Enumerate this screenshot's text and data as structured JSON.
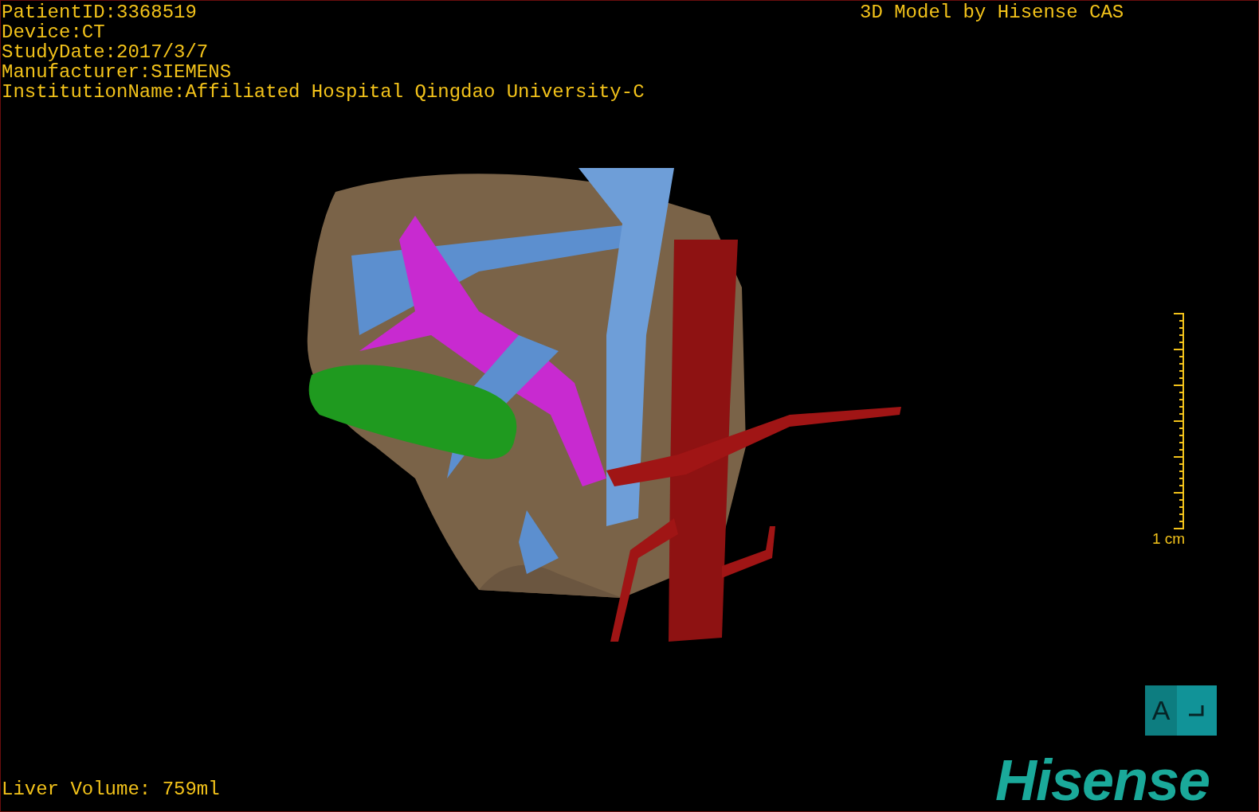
{
  "overlay_top_left": [
    "PatientID:3368519",
    "Device:CT",
    "StudyDate:2017/3/7",
    "Manufacturer:SIEMENS",
    "InstitutionName:Affiliated Hospital Qingdao University-C"
  ],
  "overlay_top_right": "3D Model by Hisense CAS",
  "scale_bar": {
    "label": "1 cm"
  },
  "orientation_cube": {
    "front_label": "A"
  },
  "liver_volume": "Liver Volume: 759ml",
  "logo": "Hisense"
}
